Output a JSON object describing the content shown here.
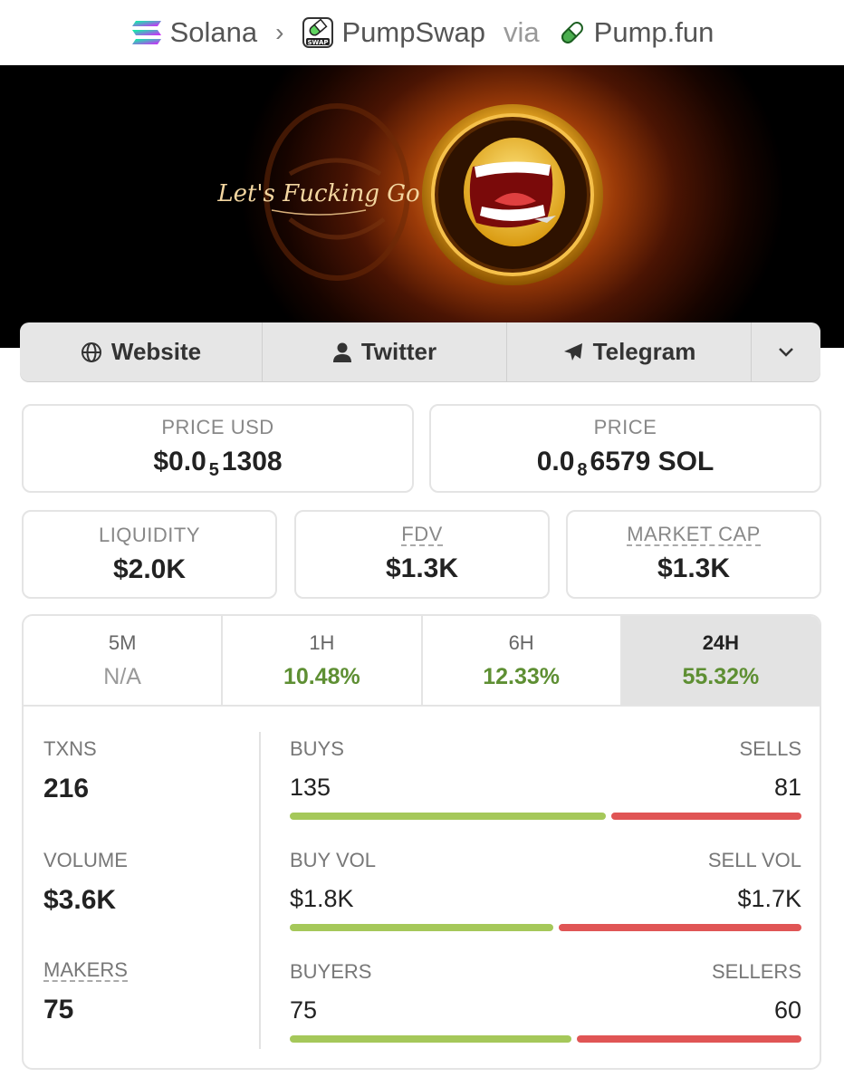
{
  "breadcrumb": {
    "chain": "Solana",
    "dex": "PumpSwap",
    "via_label": "via",
    "launchpad": "Pump.fun"
  },
  "banner": {
    "tagline": "Let's Fucking Go"
  },
  "links": {
    "website": "Website",
    "twitter": "Twitter",
    "telegram": "Telegram"
  },
  "price": {
    "usd_label": "PRICE USD",
    "usd_prefix": "$0.0",
    "usd_zeros": "5",
    "usd_digits": "1308",
    "native_label": "PRICE",
    "native_prefix": "0.0",
    "native_zeros": "8",
    "native_digits": "6579 SOL"
  },
  "metrics": {
    "liquidity_label": "LIQUIDITY",
    "liquidity": "$2.0K",
    "fdv_label": "FDV",
    "fdv": "$1.3K",
    "mcap_label": "MARKET CAP",
    "mcap": "$1.3K"
  },
  "timeframes": [
    {
      "label": "5M",
      "change": "N/A"
    },
    {
      "label": "1H",
      "change": "10.48%"
    },
    {
      "label": "6H",
      "change": "12.33%"
    },
    {
      "label": "24H",
      "change": "55.32%"
    }
  ],
  "active_timeframe": "24H",
  "stats": {
    "txns_label": "TXNS",
    "txns": "216",
    "volume_label": "VOLUME",
    "volume": "$3.6K",
    "makers_label": "MAKERS",
    "makers": "75",
    "buys_label": "BUYS",
    "buys": "135",
    "sells_label": "SELLS",
    "sells": "81",
    "buy_vol_label": "BUY VOL",
    "buy_vol": "$1.8K",
    "sell_vol_label": "SELL VOL",
    "sell_vol": "$1.7K",
    "buyers_label": "BUYERS",
    "buyers": "75",
    "sellers_label": "SELLERS",
    "sellers": "60",
    "buy_share": 0.625,
    "buy_vol_share": 0.52,
    "buyers_share": 0.556
  },
  "colors": {
    "positive": "#5e8f33",
    "buy_bar": "#a5c85a",
    "sell_bar": "#e05555"
  }
}
